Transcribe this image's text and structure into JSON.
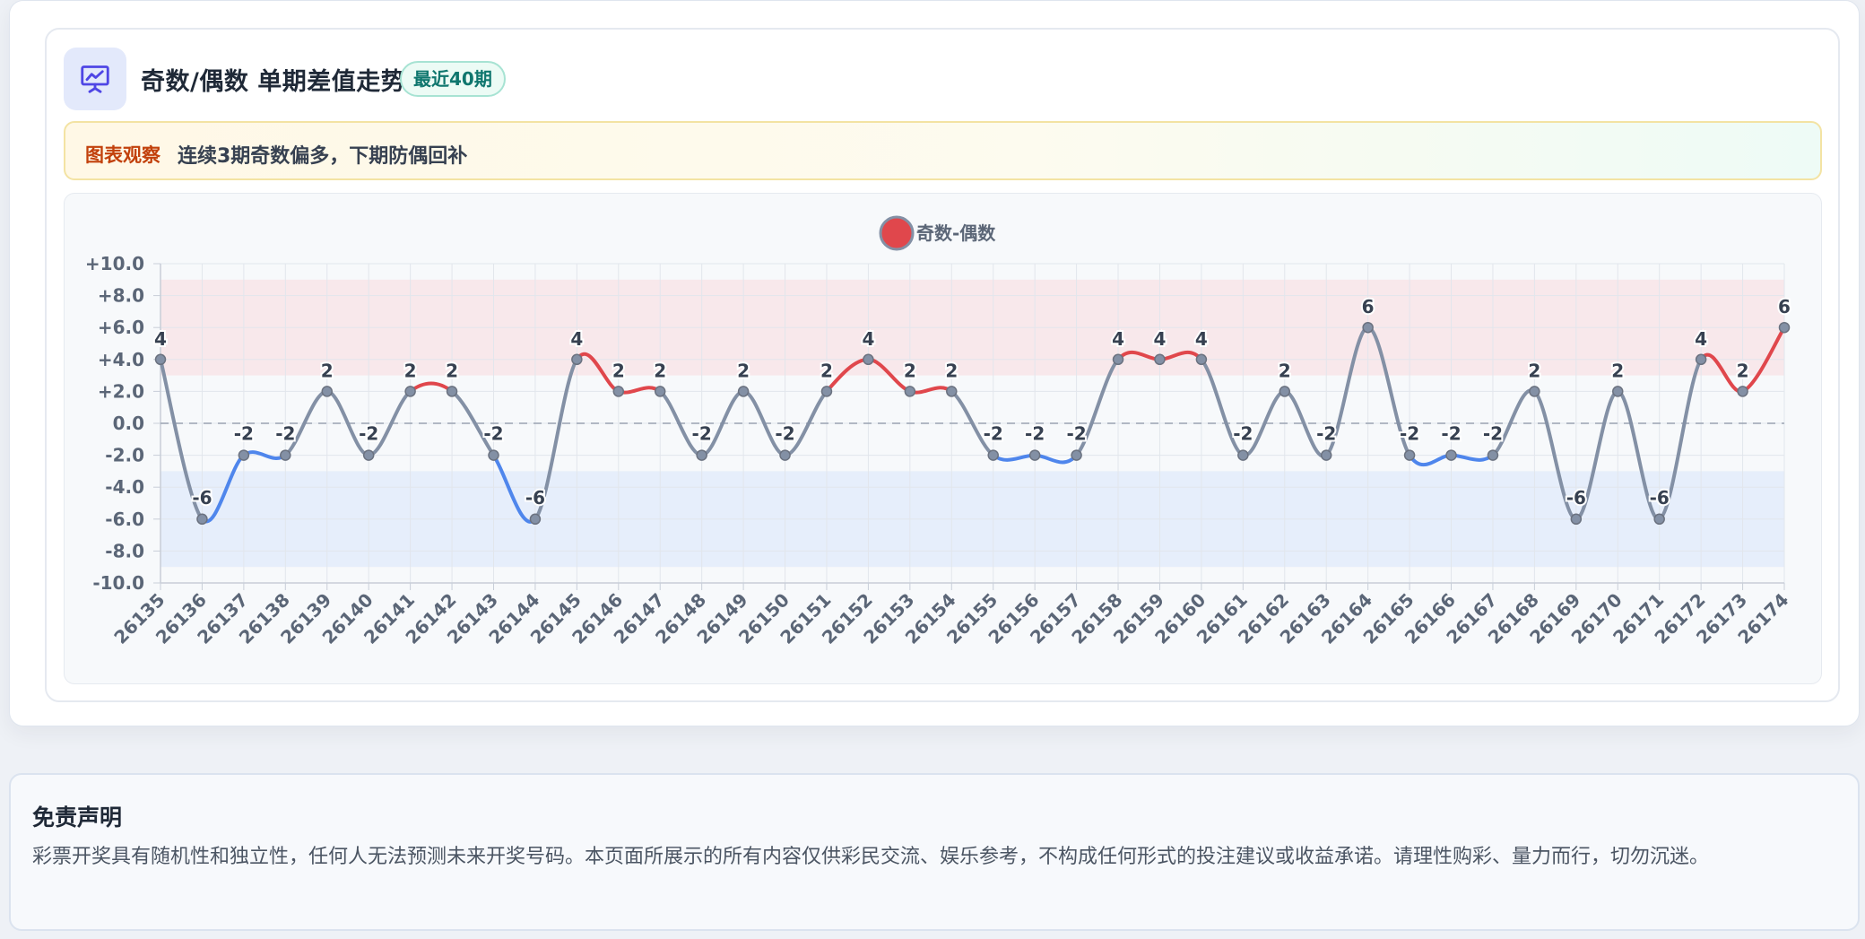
{
  "header": {
    "title": "奇数/偶数 单期差值走势",
    "badge": "最近40期",
    "icon": "presentation-chart-icon"
  },
  "insight": {
    "label": "图表观察",
    "text": "连续3期奇数偏多，下期防偶回补"
  },
  "colors": {
    "positive": "#e0474c",
    "negative": "#4f86ec",
    "neutral": "#8390a5",
    "upper_band": "#f8e8eb",
    "lower_band": "#e6eefb",
    "accent": "#4f46e5"
  },
  "chart_data": {
    "type": "line",
    "title": "",
    "xlabel": "",
    "ylabel": "",
    "ylim": [
      -10,
      10
    ],
    "y_ticks": [
      "+10.0",
      "+8.0",
      "+6.0",
      "+4.0",
      "+2.0",
      "0.0",
      "-2.0",
      "-4.0",
      "-6.0",
      "-8.0",
      "-10.0"
    ],
    "y_tick_values": [
      10,
      8,
      6,
      4,
      2,
      0,
      -2,
      -4,
      -6,
      -8,
      -10
    ],
    "grid": true,
    "legend_position": "top-center",
    "bands": [
      {
        "from": 3,
        "to": 9,
        "color": "#f8e8eb"
      },
      {
        "from": -9,
        "to": -3,
        "color": "#e6eefb"
      }
    ],
    "reference_line": 0,
    "categories": [
      "26135",
      "26136",
      "26137",
      "26138",
      "26139",
      "26140",
      "26141",
      "26142",
      "26143",
      "26144",
      "26145",
      "26146",
      "26147",
      "26148",
      "26149",
      "26150",
      "26151",
      "26152",
      "26153",
      "26154",
      "26155",
      "26156",
      "26157",
      "26158",
      "26159",
      "26160",
      "26161",
      "26162",
      "26163",
      "26164",
      "26165",
      "26166",
      "26167",
      "26168",
      "26169",
      "26170",
      "26171",
      "26172",
      "26173",
      "26174"
    ],
    "series": [
      {
        "name": "奇数-偶数",
        "values": [
          4,
          -6,
          -2,
          -2,
          2,
          -2,
          2,
          2,
          -2,
          -6,
          4,
          2,
          2,
          -2,
          2,
          -2,
          2,
          4,
          2,
          2,
          -2,
          -2,
          -2,
          4,
          4,
          4,
          -2,
          2,
          -2,
          6,
          -2,
          -2,
          -2,
          2,
          -6,
          2,
          -6,
          4,
          2,
          6
        ],
        "labels": [
          "4",
          "-6",
          "-2",
          "-2",
          "2",
          "-2",
          "2",
          "2",
          "-2",
          "-6",
          "4",
          "2",
          "2",
          "-2",
          "2",
          "-2",
          "2",
          "4",
          "2",
          "2",
          "-2",
          "-2",
          "-2",
          "4",
          "4",
          "4",
          "-2",
          "2",
          "-2",
          "6",
          "-2",
          "-2",
          "-2",
          "2",
          "-6",
          "2",
          "-6",
          "4",
          "2",
          "6"
        ]
      }
    ]
  },
  "disclaimer": {
    "title": "免责声明",
    "text": "彩票开奖具有随机性和独立性，任何人无法预测未来开奖号码。本页面所展示的所有内容仅供彩民交流、娱乐参考，不构成任何形式的投注建议或收益承诺。请理性购彩、量力而行，切勿沉迷。"
  }
}
